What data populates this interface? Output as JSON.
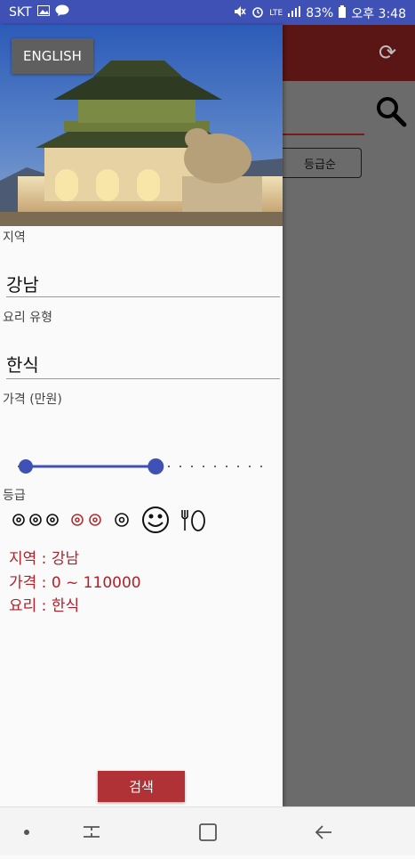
{
  "status_bar": {
    "carrier": "SKT",
    "battery": "83%",
    "network": "LTE",
    "time": "오후 3:48"
  },
  "background": {
    "sort_button_label": "등급순"
  },
  "drawer": {
    "english_button_label": "ENGLISH",
    "region": {
      "label": "지역",
      "value": "강남"
    },
    "cuisine": {
      "label": "요리 유형",
      "value": "한식"
    },
    "price": {
      "label": "가격 (만원)",
      "min_fraction": 0.0,
      "max_fraction": 0.55
    },
    "grade": {
      "label": "등급",
      "icons": [
        "three-star-icon",
        "two-star-icon",
        "one-star-icon",
        "bib-gourmand-icon",
        "plate-icon"
      ]
    },
    "summary": {
      "region": "지역 : 강남",
      "price": "가격 : 0 ~ 110000",
      "cuisine": "요리 : 한식"
    },
    "search_button_label": "검색"
  },
  "colors": {
    "status_bar": "#3f51b5",
    "accent_red": "#b03237",
    "slider_blue": "#3f51b5"
  }
}
